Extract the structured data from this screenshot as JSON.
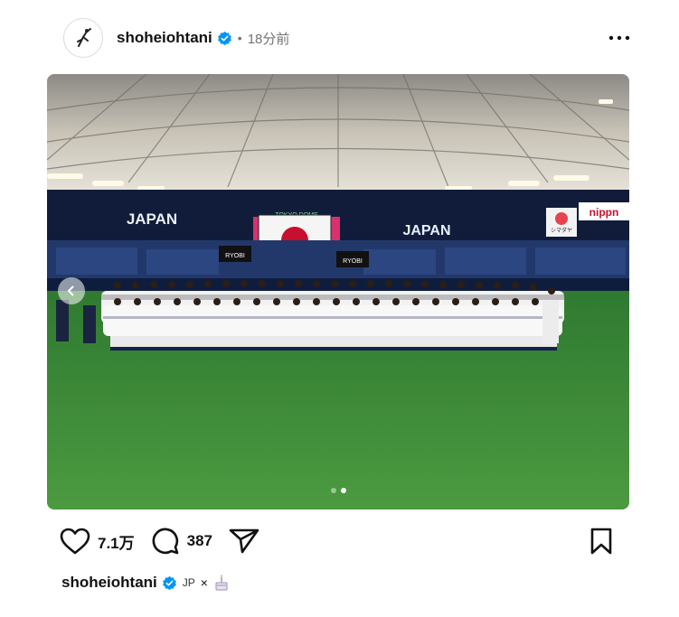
{
  "post": {
    "username": "shoheiohtani",
    "time_ago": "18分前",
    "dot": "•",
    "verified": true
  },
  "photo": {
    "banner_left": "JAPAN",
    "banner_right": "JAPAN",
    "dome_text": "TOKYO DOME",
    "sponsor_1": "nippn",
    "sponsor_2": "シマダヤ",
    "sponsor_3": "RYOBI",
    "sponsor_4": "RYOBI",
    "carousel_count": 2,
    "carousel_active_index": 1
  },
  "actions": {
    "likes": "7.1万",
    "comments": "387"
  },
  "caption": {
    "username": "shoheiohtani",
    "text": "JP",
    "symbol": "×"
  },
  "colors": {
    "verified_blue": "#0095f6",
    "grass": "#3f8f3a",
    "banner_navy": "#101c3a",
    "flag_red": "#c8102e"
  }
}
